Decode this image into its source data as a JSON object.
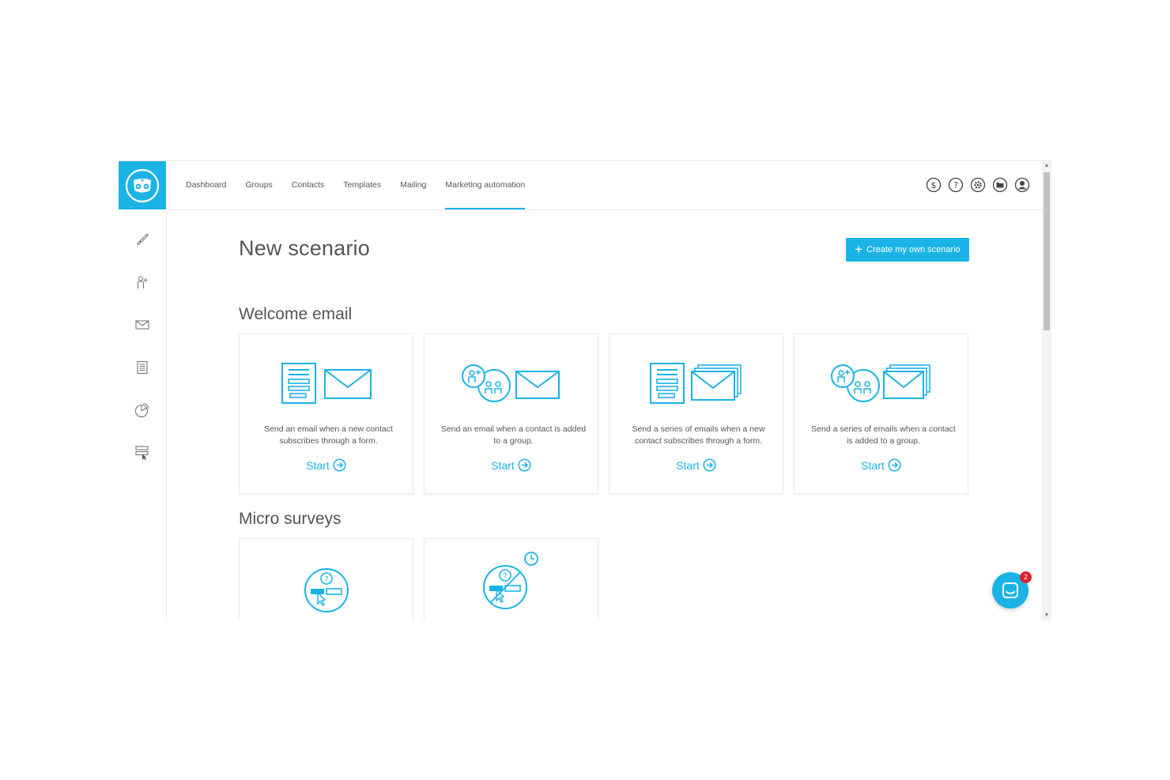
{
  "topnav": {
    "items": [
      {
        "label": "Dashboard"
      },
      {
        "label": "Groups"
      },
      {
        "label": "Contacts"
      },
      {
        "label": "Templates"
      },
      {
        "label": "Mailing"
      },
      {
        "label": "Marketing automation"
      }
    ],
    "active_index": 5,
    "icons": [
      "dollar-icon",
      "help-icon",
      "settings-icon",
      "folder-icon",
      "user-icon"
    ]
  },
  "sidebar": {
    "icons": [
      "brush-icon",
      "add-contact-icon",
      "envelope-icon",
      "document-icon",
      "pie-chart-icon",
      "form-icon"
    ]
  },
  "main": {
    "title": "New scenario",
    "create_button_label": "Create my own scenario"
  },
  "sections": {
    "welcome": {
      "title": "Welcome email",
      "cards": [
        {
          "description": "Send an email when a new contact subscribes through a form.",
          "start_label": "Start"
        },
        {
          "description": "Send an email when a contact is added to a group.",
          "start_label": "Start"
        },
        {
          "description": "Send a series of emails when a new contact subscribes through a form.",
          "start_label": "Start"
        },
        {
          "description": "Send a series of emails when a contact is added to a group.",
          "start_label": "Start"
        }
      ]
    },
    "micro": {
      "title": "Micro surveys"
    }
  },
  "chat": {
    "badge_count": "2"
  },
  "colors": {
    "accent": "#1bb3e6",
    "badge": "#d9262b"
  }
}
